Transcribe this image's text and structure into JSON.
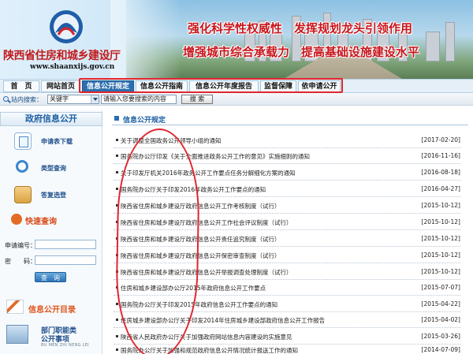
{
  "header": {
    "site_name": "陕西省住房和城乡建设厅",
    "site_url": "www.shaanxijs.gov.cn",
    "slogan_1": "强化科学性权威性　发挥规划龙头引领作用",
    "slogan_2": "增强城市综合承载力　提高基础设施建设水平"
  },
  "nav": {
    "items": [
      "首　页",
      "网站首页",
      "信息公开规定",
      "信息公开指南",
      "信息公开年度报告",
      "监督保障",
      "依申请公开"
    ],
    "active_index": 2
  },
  "search": {
    "label": "站内搜索：",
    "select_value": "关键字",
    "input_value": "请输入您要搜索的内容",
    "button_label": "搜 索"
  },
  "sidebar": {
    "title": "政府信息公开",
    "links": [
      {
        "label": "申请表下载",
        "icon": "form-icon"
      },
      {
        "label": "类型查询",
        "icon": "magnifier-icon"
      },
      {
        "label": "答复选登",
        "icon": "box-icon"
      }
    ],
    "quick_query_title": "快速查询",
    "fields": [
      {
        "label": "申请编号：",
        "value": ""
      },
      {
        "label": "密　　码：",
        "value": ""
      }
    ],
    "query_button": "查　询",
    "catalog_title": "信息公开目录",
    "dept": {
      "line1": "部门职能类",
      "line2": "公开事项",
      "pinyin": "BU MEN ZHI NENG LEI"
    }
  },
  "main": {
    "section_title": "信息公开规定",
    "items": [
      {
        "title": "关于调整全国政务公开领导小组的通知",
        "date": "[2017-02-20]"
      },
      {
        "title": "国务院办公厅印发《关于全面推进政务公开工作的意见》实施细则的通知",
        "date": "[2016-11-16]"
      },
      {
        "title": "关于印发厅机关2016年政务公开工作要点任务分解细化方案的通知",
        "date": "[2016-08-18]"
      },
      {
        "title": "国务院办公厅关于印发2016年政务公开工作要点的通知",
        "date": "[2016-04-27]"
      },
      {
        "title": "陕西省住房和城乡建设厅政府信息公开工作考核制度（试行）",
        "date": "[2015-10-12]"
      },
      {
        "title": "陕西省住房和城乡建设厅政府信息公开工作社会评议制度（试行）",
        "date": "[2015-10-12]"
      },
      {
        "title": "陕西省住房和城乡建设厅政府信息公开责任追究制度（试行）",
        "date": "[2015-10-12]"
      },
      {
        "title": "陕西省住房和城乡建设厅政府信息公开保密审查制度（试行）",
        "date": "[2015-10-12]"
      },
      {
        "title": "陕西省住房和城乡建设厅政府信息公开举报调查处理制度（试行）",
        "date": "[2015-10-12]"
      },
      {
        "title": "住房和城乡建设部办公厅2015年政府信息公开工作要点",
        "date": "[2015-07-07]"
      },
      {
        "title": "国务院办公厅关于印发2015年政府信息公开工作要点的通知",
        "date": "[2015-04-22]"
      },
      {
        "title": "住房城乡建设部办公厅关于印发2014年住房城乡建设部政府信息公开工作报告",
        "date": "[2015-04-02]"
      },
      {
        "title": "陕西省人民政府办公厅关于加强政府网站信息内容建设的实施意见",
        "date": "[2015-03-26]"
      },
      {
        "title": "国务院办公厅关于加强和规范政府信息公开情况统计报送工作的通知",
        "date": "[2014-07-09]"
      }
    ]
  }
}
